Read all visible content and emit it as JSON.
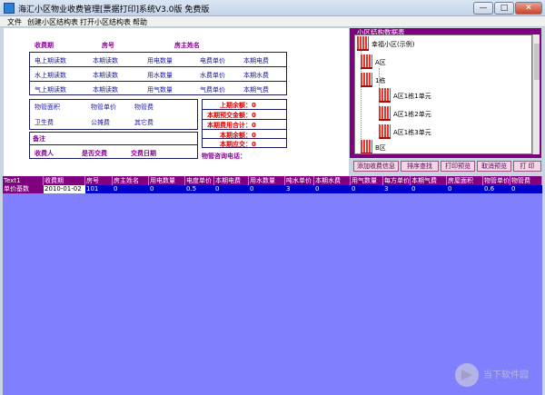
{
  "window": {
    "title": "海汇小区物业收费管理[票据打印]系统V3.0版 免费版",
    "controls": {
      "minimize": "—",
      "maximize": "□",
      "close": "✕"
    }
  },
  "menu": [
    "文件",
    "创建小区结构表",
    "打开小区结构表",
    "帮助"
  ],
  "form": {
    "header": [
      "收费期",
      "房号",
      "房主姓名"
    ],
    "electric": [
      "电上期读数",
      "本期读数",
      "用电数量",
      "电费单价",
      "本期电费"
    ],
    "water": [
      "水上期读数",
      "本期读数",
      "用水数量",
      "水费单价",
      "本期水费"
    ],
    "gas": [
      "气上期读数",
      "本期读数",
      "用气数量",
      "气费单价",
      "本期气费"
    ],
    "property": [
      "物管面积",
      "物管单价",
      "物管费"
    ],
    "misc": [
      "卫生费",
      "公摊费",
      "其它费"
    ],
    "remark": "备注",
    "bottom": [
      "收费人",
      "是否交费",
      "交费日期"
    ],
    "summary": [
      "上期余额：0",
      "本期预交金额：0",
      "本期费用合计：0",
      "本期余额：0",
      "本期应交：0"
    ],
    "consult": "物管咨询电话："
  },
  "tree": {
    "title": "小区结构数据表",
    "nodes": [
      "幸福小区(示例)",
      "A区",
      "1栋",
      "A区1栋1单元",
      "A区1栋2单元",
      "A区1栋3单元",
      "B区"
    ]
  },
  "buttons": [
    "添加收费信息",
    "排序查找",
    "打印预览",
    "取消预览",
    "打 印"
  ],
  "grid": {
    "columns": [
      "Text1",
      "收费期",
      "房号",
      "房主姓名",
      "用电数量",
      "电度单价",
      "本期电费",
      "用水数量",
      "吨水单价",
      "本期水费",
      "用气数量",
      "每方单价",
      "本期气费",
      "房屋面积",
      "物管单价",
      "物管费"
    ],
    "row": [
      "单价基数",
      "2010-01-02",
      "101",
      "0",
      "0",
      "0.5",
      "0",
      "0",
      "3",
      "0",
      "0",
      "3",
      "0",
      "0",
      "0.6",
      "0"
    ]
  },
  "watermark": "当下软件园"
}
